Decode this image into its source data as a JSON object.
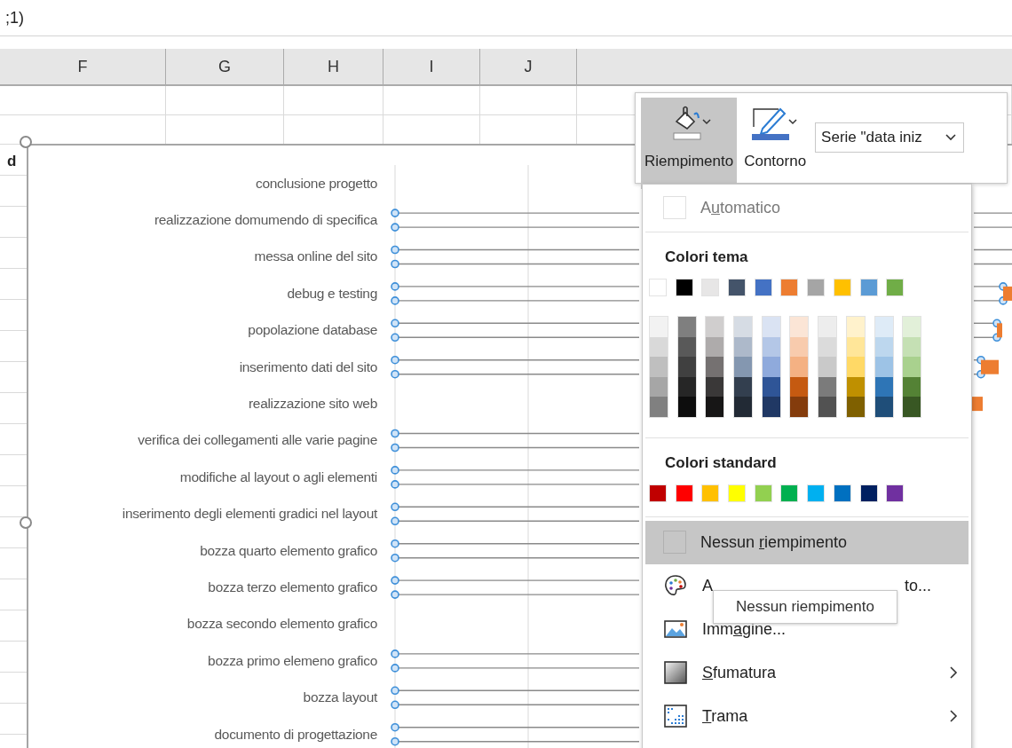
{
  "formula_bar": {
    "text": ";1)"
  },
  "columns": [
    {
      "label": "F"
    },
    {
      "label": "G"
    },
    {
      "label": "H"
    },
    {
      "label": "I"
    },
    {
      "label": "J"
    }
  ],
  "cell_fragment": "d",
  "chart": {
    "tasks": [
      {
        "label": "conclusione progetto",
        "handles": false
      },
      {
        "label": "realizzazione domumendo di specifica",
        "handles": true
      },
      {
        "label": "messa online del sito",
        "handles": true
      },
      {
        "label": "debug e testing",
        "handles": true
      },
      {
        "label": "popolazione database",
        "handles": true
      },
      {
        "label": "inserimento dati del sito",
        "handles": true
      },
      {
        "label": "realizzazione sito web",
        "handles": false
      },
      {
        "label": "verifica dei collegamenti alle varie pagine",
        "handles": true
      },
      {
        "label": "modifiche al layout o agli elementi",
        "handles": true
      },
      {
        "label": "inserimento degli elementi gradici nel layout",
        "handles": true
      },
      {
        "label": "bozza quarto elemento grafico",
        "handles": true
      },
      {
        "label": "bozza terzo elemento grafico",
        "handles": true
      },
      {
        "label": "bozza secondo elemento grafico",
        "handles": false
      },
      {
        "label": "bozza primo elemeno grafico",
        "handles": true
      },
      {
        "label": "bozza layout",
        "handles": true
      },
      {
        "label": "documento di progettazione",
        "handles": true
      }
    ]
  },
  "toolbar": {
    "buttons": [
      {
        "kind": "fill",
        "label": "Riempimento",
        "selected": true
      },
      {
        "kind": "outline",
        "label": "Contorno",
        "selected": false
      }
    ],
    "series_dropdown": {
      "value": "Serie \"data iniz"
    }
  },
  "menu": {
    "automatic": {
      "label": [
        "A",
        "u",
        "tomatico"
      ],
      "disabled": true
    },
    "theme_colors": {
      "title": "Colori tema",
      "colors": [
        {
          "color": "#ffffff",
          "shades": [
            {
              "color": "#f2f2f2"
            },
            {
              "color": "#d9d9d9"
            },
            {
              "color": "#bfbfbf"
            },
            {
              "color": "#a6a6a6"
            },
            {
              "color": "#808080"
            }
          ]
        },
        {
          "color": "#000000",
          "shades": [
            {
              "color": "#7f7f7f"
            },
            {
              "color": "#595959"
            },
            {
              "color": "#404040"
            },
            {
              "color": "#262626"
            },
            {
              "color": "#0d0d0d"
            }
          ]
        },
        {
          "color": "#e7e6e6",
          "shades": [
            {
              "color": "#d0cece"
            },
            {
              "color": "#aeabab"
            },
            {
              "color": "#757171"
            },
            {
              "color": "#3a3838"
            },
            {
              "color": "#171616"
            }
          ]
        },
        {
          "color": "#44546a",
          "shades": [
            {
              "color": "#d6dce4"
            },
            {
              "color": "#adb9ca"
            },
            {
              "color": "#8497b0"
            },
            {
              "color": "#333f4f"
            },
            {
              "color": "#222a35"
            }
          ]
        },
        {
          "color": "#4472c4",
          "shades": [
            {
              "color": "#dae3f3"
            },
            {
              "color": "#b4c7e7"
            },
            {
              "color": "#8faadc"
            },
            {
              "color": "#2f5597"
            },
            {
              "color": "#203864"
            }
          ]
        },
        {
          "color": "#ed7d31",
          "shades": [
            {
              "color": "#fbe5d6"
            },
            {
              "color": "#f8cbad"
            },
            {
              "color": "#f4b183"
            },
            {
              "color": "#c55a11"
            },
            {
              "color": "#843c0c"
            }
          ]
        },
        {
          "color": "#a5a5a5",
          "shades": [
            {
              "color": "#ededed"
            },
            {
              "color": "#dbdbdb"
            },
            {
              "color": "#c9c9c9"
            },
            {
              "color": "#7b7b7b"
            },
            {
              "color": "#525252"
            }
          ]
        },
        {
          "color": "#ffc000",
          "shades": [
            {
              "color": "#fff2cc"
            },
            {
              "color": "#ffe699"
            },
            {
              "color": "#ffd966"
            },
            {
              "color": "#bf9000"
            },
            {
              "color": "#7f6000"
            }
          ]
        },
        {
          "color": "#5b9bd5",
          "shades": [
            {
              "color": "#deebf7"
            },
            {
              "color": "#bdd7ee"
            },
            {
              "color": "#9dc3e6"
            },
            {
              "color": "#2e75b6"
            },
            {
              "color": "#1f4e79"
            }
          ]
        },
        {
          "color": "#70ad47",
          "shades": [
            {
              "color": "#e2f0d9"
            },
            {
              "color": "#c5e0b4"
            },
            {
              "color": "#a9d18e"
            },
            {
              "color": "#548235"
            },
            {
              "color": "#385723"
            }
          ]
        }
      ]
    },
    "standard_colors": {
      "title": "Colori standard",
      "colors": [
        {
          "color": "#c00000"
        },
        {
          "color": "#ff0000"
        },
        {
          "color": "#ffc000"
        },
        {
          "color": "#ffff00"
        },
        {
          "color": "#92d050"
        },
        {
          "color": "#00b050"
        },
        {
          "color": "#00b0f0"
        },
        {
          "color": "#0070c0"
        },
        {
          "color": "#002060"
        },
        {
          "color": "#7030a0"
        }
      ]
    },
    "items": [
      {
        "kind": "no-fill",
        "label": {
          "before": "Nessun ",
          "key": "r",
          "after": "iempimento"
        },
        "selected": true,
        "submenu": false
      },
      {
        "kind": "more-colors",
        "label_start": "A",
        "label_end": "to...",
        "selected": false,
        "submenu": false
      },
      {
        "kind": "picture",
        "label": {
          "before": "Imm",
          "key": "a",
          "after": "gine..."
        },
        "selected": false,
        "submenu": false
      },
      {
        "kind": "gradient",
        "label": {
          "key": "S",
          "after": "fumatura"
        },
        "selected": false,
        "submenu": true
      },
      {
        "kind": "pattern",
        "label": {
          "key": "T",
          "after": "rama"
        },
        "selected": false,
        "submenu": true
      }
    ]
  },
  "tooltip": {
    "text": "Nessun riempimento"
  }
}
